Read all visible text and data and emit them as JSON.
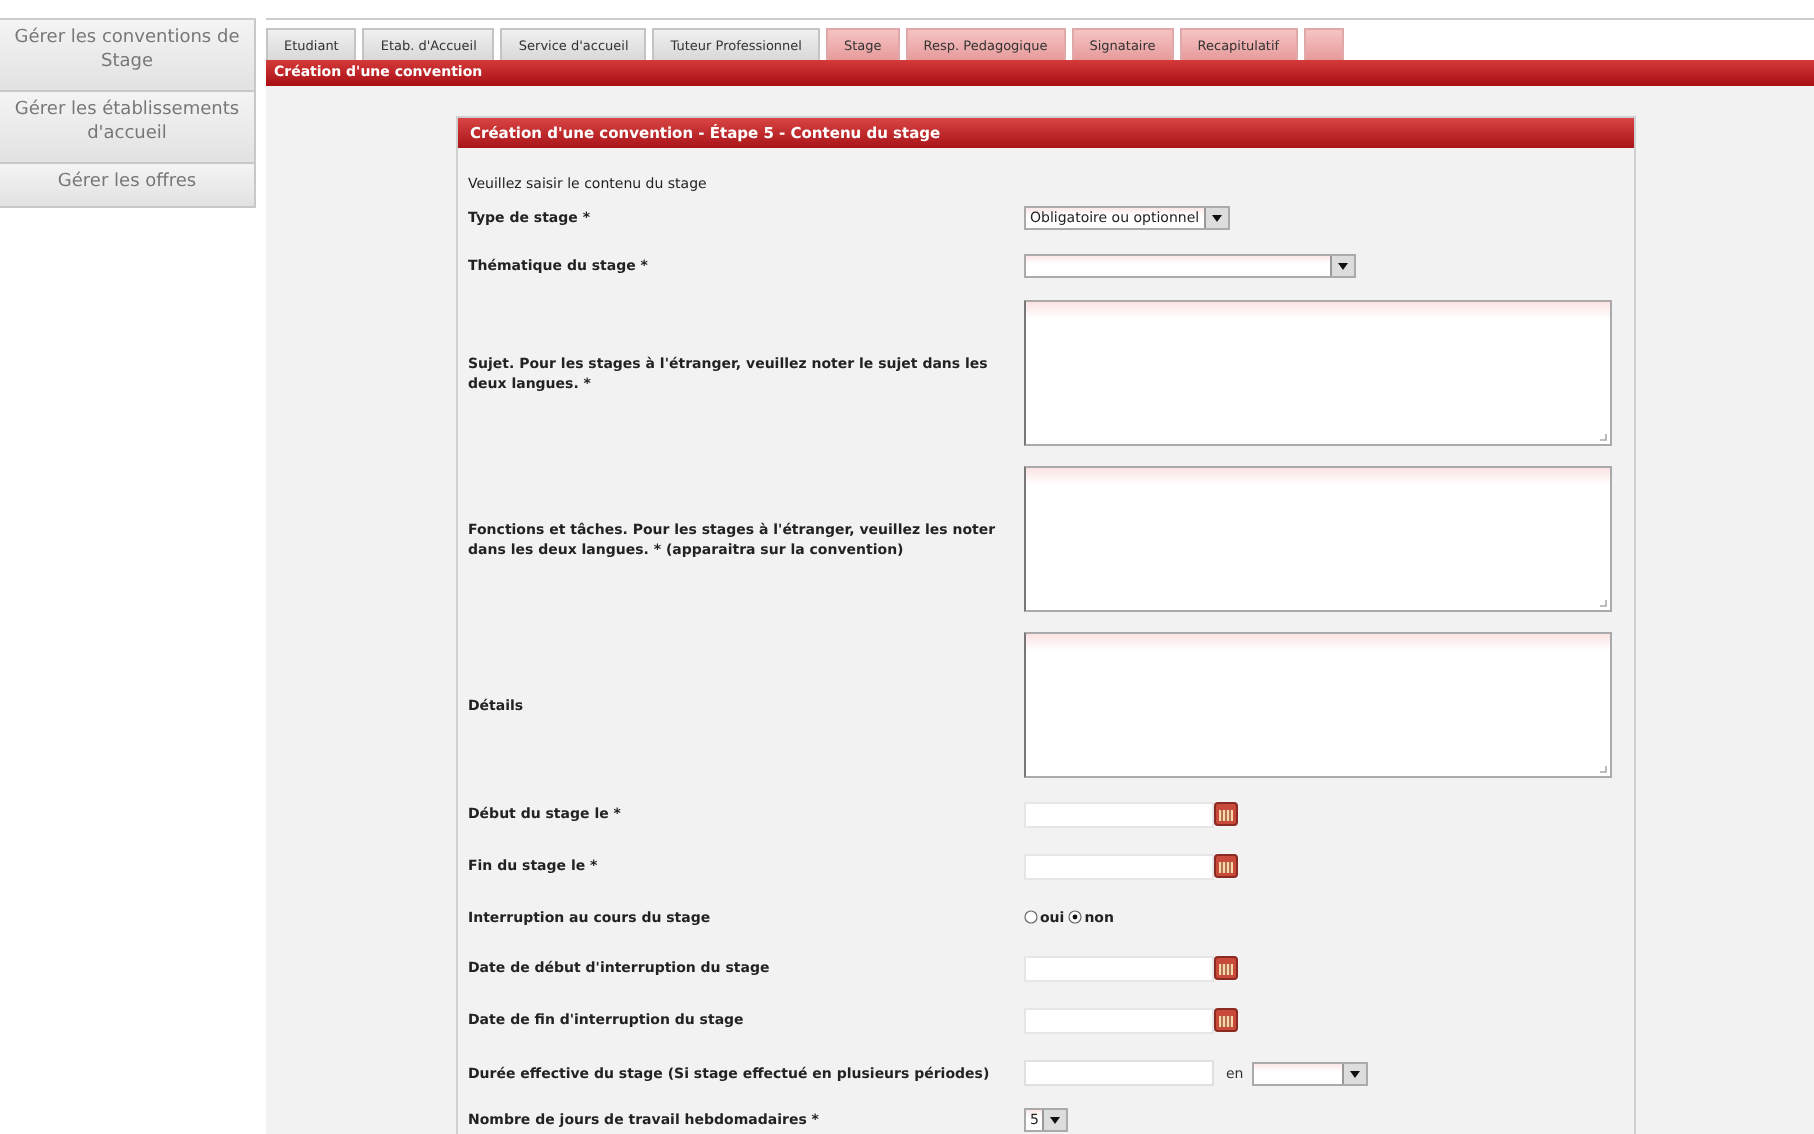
{
  "sidebar": {
    "items": [
      {
        "label": "Gérer les conventions de Stage",
        "selected": false
      },
      {
        "label": "Gérer les établissements d'accueil",
        "selected": false
      },
      {
        "label": "Gérer les offres",
        "selected": false
      }
    ]
  },
  "tabs": [
    {
      "label": "Etudiant",
      "completed": true
    },
    {
      "label": "Etab. d'Accueil",
      "completed": true
    },
    {
      "label": "Service d'accueil",
      "completed": true
    },
    {
      "label": "Tuteur Professionnel",
      "completed": true
    },
    {
      "label": "Stage",
      "completed": false
    },
    {
      "label": "Resp. Pedagogique",
      "completed": false
    },
    {
      "label": "Signataire",
      "completed": false
    },
    {
      "label": "Recapitulatif",
      "completed": false
    }
  ],
  "page_header": "Création d'une convention",
  "panel": {
    "title": "Création d'une convention - Étape 5 - Contenu du stage",
    "intro": "Veuillez saisir le contenu du stage",
    "fields": [
      {
        "kind": "select",
        "label": "Type de stage *",
        "value": "Obligatoire ou optionnel"
      },
      {
        "kind": "select",
        "label": "Thématique du stage *"
      },
      {
        "kind": "textarea",
        "label": "Sujet. Pour les stages à l'étranger, veuillez noter le sujet dans les deux langues. *"
      },
      {
        "kind": "textarea",
        "label": "Fonctions et tâches. Pour les stages à l'étranger, veuillez les noter dans les deux langues. * (apparaitra sur la convention)"
      },
      {
        "kind": "textarea",
        "label": "Détails"
      },
      {
        "kind": "date",
        "label": "Début du stage le *"
      },
      {
        "kind": "date",
        "label": "Fin du stage le *"
      },
      {
        "kind": "radio",
        "label": "Interruption au cours du stage",
        "options": [
          {
            "label": "oui",
            "selected": false
          },
          {
            "label": "non",
            "selected": true
          }
        ]
      },
      {
        "kind": "date",
        "label": "Date de début d'interruption du stage"
      },
      {
        "kind": "date",
        "label": "Date de fin d'interruption du stage"
      },
      {
        "kind": "duration",
        "label": "Durée effective du stage (Si stage effectué en plusieurs périodes)",
        "unit_label": "en"
      },
      {
        "kind": "small-select",
        "label": "Nombre de jours de travail hebdomadaires *",
        "value": "5"
      }
    ]
  }
}
